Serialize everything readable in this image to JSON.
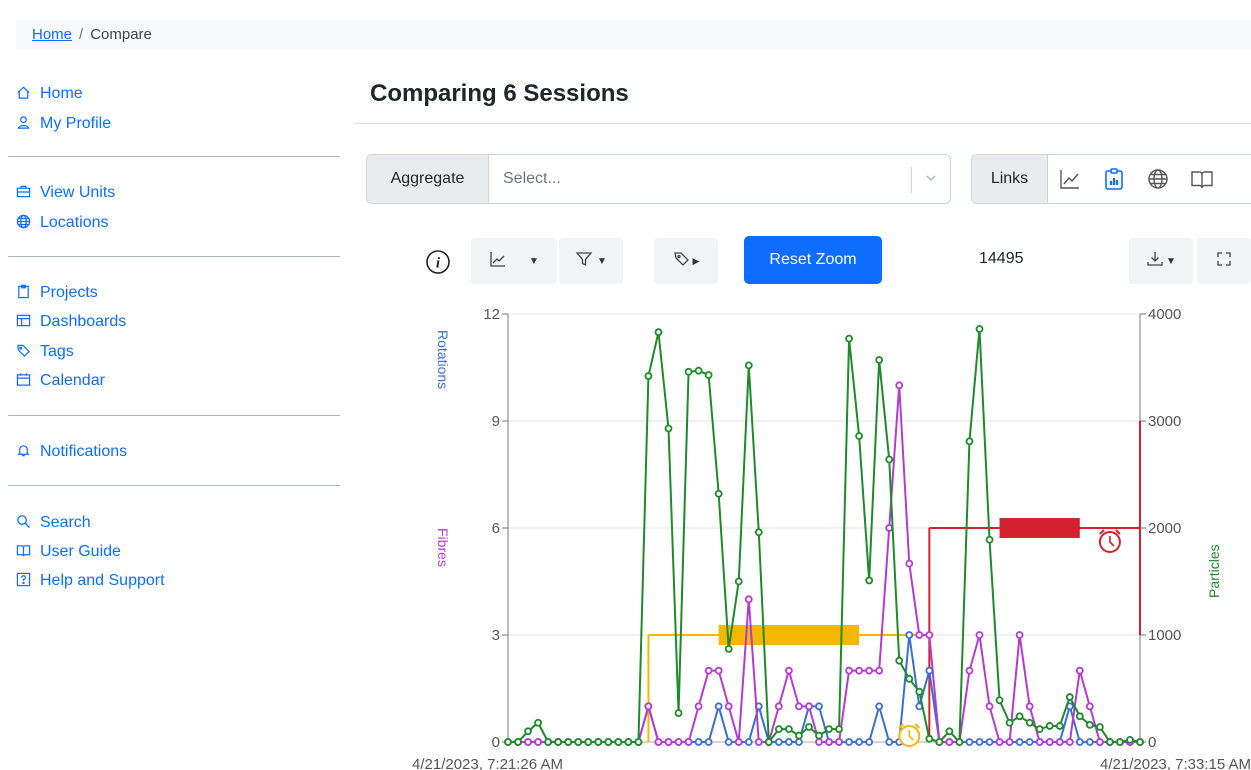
{
  "breadcrumb": {
    "home": "Home",
    "separator": "/",
    "current": "Compare"
  },
  "sidebar": {
    "groups": [
      [
        {
          "label": "Home",
          "icon": "home-icon"
        },
        {
          "label": "My Profile",
          "icon": "user-icon"
        }
      ],
      [
        {
          "label": "View Units",
          "icon": "briefcase-icon"
        },
        {
          "label": "Locations",
          "icon": "globe-icon"
        }
      ],
      [
        {
          "label": "Projects",
          "icon": "clipboard-icon"
        },
        {
          "label": "Dashboards",
          "icon": "dashboard-icon"
        },
        {
          "label": "Tags",
          "icon": "tags-icon"
        },
        {
          "label": "Calendar",
          "icon": "calendar-icon"
        }
      ],
      [
        {
          "label": "Notifications",
          "icon": "bell-icon"
        }
      ],
      [
        {
          "label": "Search",
          "icon": "search-icon"
        },
        {
          "label": "User Guide",
          "icon": "book-icon"
        },
        {
          "label": "Help and Support",
          "icon": "question-icon"
        }
      ]
    ]
  },
  "main": {
    "title": "Comparing 6 Sessions",
    "aggregate": {
      "label": "Aggregate",
      "placeholder": "Select..."
    },
    "links": {
      "label": "Links",
      "icons": [
        "line-chart-icon",
        "report-icon",
        "globe-icon",
        "book-icon"
      ]
    }
  },
  "toolbar": {
    "reset_zoom": "Reset Zoom",
    "count": "14495",
    "icons": [
      "info-icon",
      "chart-type-icon",
      "filter-icon",
      "tag-icon",
      "download-icon",
      "fullscreen-icon"
    ]
  },
  "chart_data": {
    "type": "line",
    "x_start_label": "4/21/2023, 7:21:26 AM",
    "x_end_label": "4/21/2023, 7:33:15 AM",
    "n_points": 64,
    "left_axis": {
      "labels": [
        "Rotations",
        "Fibres"
      ],
      "ylim": [
        0,
        12
      ],
      "ticks": [
        "0",
        "3",
        "6",
        "9",
        "12"
      ]
    },
    "right_axis": {
      "label": "Particles",
      "ylim": [
        0,
        4000
      ],
      "ticks": [
        "0",
        "1000",
        "2000",
        "3000",
        "4000"
      ]
    },
    "colors": {
      "rotations": "#3a6fd0",
      "fibres": "#b23cd1",
      "particles": "#1f8a2a",
      "yellow": "#f5b800",
      "red": "#d3222f"
    },
    "series": [
      {
        "name": "Rotations",
        "axis": "left",
        "values": [
          0,
          0,
          0,
          0,
          0,
          0,
          0,
          0,
          0,
          0,
          0,
          0,
          0,
          0,
          1,
          0,
          0,
          0,
          0,
          0,
          0,
          1,
          0,
          0,
          0,
          1,
          0,
          0,
          0,
          0,
          1,
          1,
          0,
          0,
          0,
          0,
          0,
          1,
          0,
          0,
          3,
          1,
          2,
          0,
          0,
          0,
          0,
          0,
          0,
          0,
          0,
          0,
          0,
          0,
          0,
          0,
          1,
          0,
          0,
          0,
          0,
          0,
          0,
          0
        ]
      },
      {
        "name": "Fibres",
        "axis": "left",
        "values": [
          0,
          0,
          0,
          0,
          0,
          0,
          0,
          0,
          0,
          0,
          0,
          0,
          0,
          0,
          1,
          0,
          0,
          0,
          0,
          1,
          2,
          2,
          1,
          0,
          4,
          0,
          0,
          1,
          2,
          1,
          1,
          0,
          0,
          0,
          2,
          2,
          2,
          2,
          6,
          10,
          5,
          3,
          3,
          0,
          0,
          0,
          2,
          3,
          1,
          0,
          0,
          3,
          1,
          0,
          0,
          0,
          0,
          2,
          1,
          0,
          0,
          0,
          0,
          0
        ]
      },
      {
        "name": "Particles",
        "axis": "right",
        "values": [
          0,
          0,
          100,
          180,
          0,
          0,
          0,
          0,
          0,
          0,
          0,
          0,
          0,
          0,
          3420,
          3830,
          2930,
          270,
          3460,
          3470,
          3430,
          2320,
          870,
          1500,
          3520,
          1960,
          0,
          120,
          120,
          60,
          140,
          60,
          120,
          120,
          3770,
          2860,
          1510,
          3570,
          2640,
          760,
          590,
          470,
          30,
          0,
          100,
          0,
          2810,
          3860,
          1890,
          390,
          180,
          240,
          180,
          120,
          150,
          150,
          420,
          240,
          160,
          140,
          0,
          0,
          20,
          0
        ]
      }
    ],
    "markers": [
      {
        "color": "yellow",
        "from": 14,
        "to": 42,
        "y": 1000,
        "bar_from": 21,
        "bar_to": 35,
        "icon_at": 40
      },
      {
        "color": "red",
        "from": 42,
        "to": 63,
        "y": 2000,
        "bar_from": 49,
        "bar_to": 57,
        "icon_at": 60
      }
    ]
  }
}
